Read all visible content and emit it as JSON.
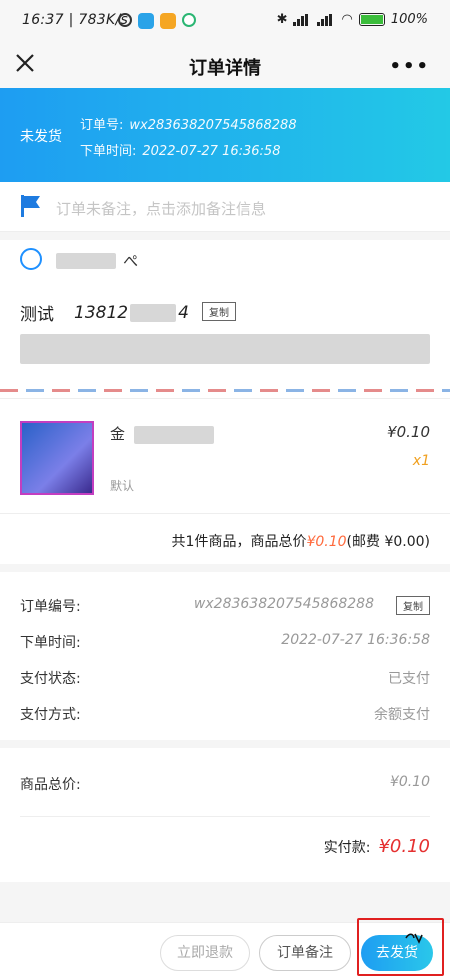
{
  "statusbar": {
    "time_speed": "16:37 | 783K/s",
    "battery": "100%"
  },
  "navbar": {
    "title": "订单详情",
    "close_icon": "close-icon",
    "more_label": "•••"
  },
  "banner": {
    "state": "未发货",
    "order_no_label": "订单号:",
    "order_no": "wx283638207545868288",
    "order_time_label": "下单时间:",
    "order_time": "2022-07-27 16:36:58"
  },
  "remark": {
    "placeholder": "订单未备注，点击添加备注信息"
  },
  "address": {
    "buyer_suffix": "ぺ",
    "contact_name": "测试",
    "phone_prefix": "13812",
    "phone_suffix": "4",
    "copy_label": "复制"
  },
  "goods": {
    "name_prefix": "金",
    "price": "¥0.10",
    "qty": "x1",
    "spec": "默认",
    "summary_prefix": "共1件商品，商品总价",
    "summary_amount": "¥0.10",
    "summary_shipping": "(邮费 ¥0.00)"
  },
  "info": {
    "rows": [
      {
        "key": "订单编号:",
        "value": "wx283638207545868288"
      },
      {
        "key": "下单时间:",
        "value": "2022-07-27 16:36:58"
      },
      {
        "key": "支付状态:",
        "value": "已支付"
      },
      {
        "key": "支付方式:",
        "value": "余额支付"
      }
    ],
    "copy_label": "复制"
  },
  "totals": {
    "goods_total_label": "商品总价:",
    "goods_total": "¥0.10",
    "paid_label": "实付款:",
    "paid": "¥0.10"
  },
  "actions": {
    "refund": "立即退款",
    "note": "订单备注",
    "ship": "去发货"
  },
  "colors": {
    "accent": "#1e9df2",
    "price_red": "#e53030",
    "qty_orange": "#f0a020"
  }
}
